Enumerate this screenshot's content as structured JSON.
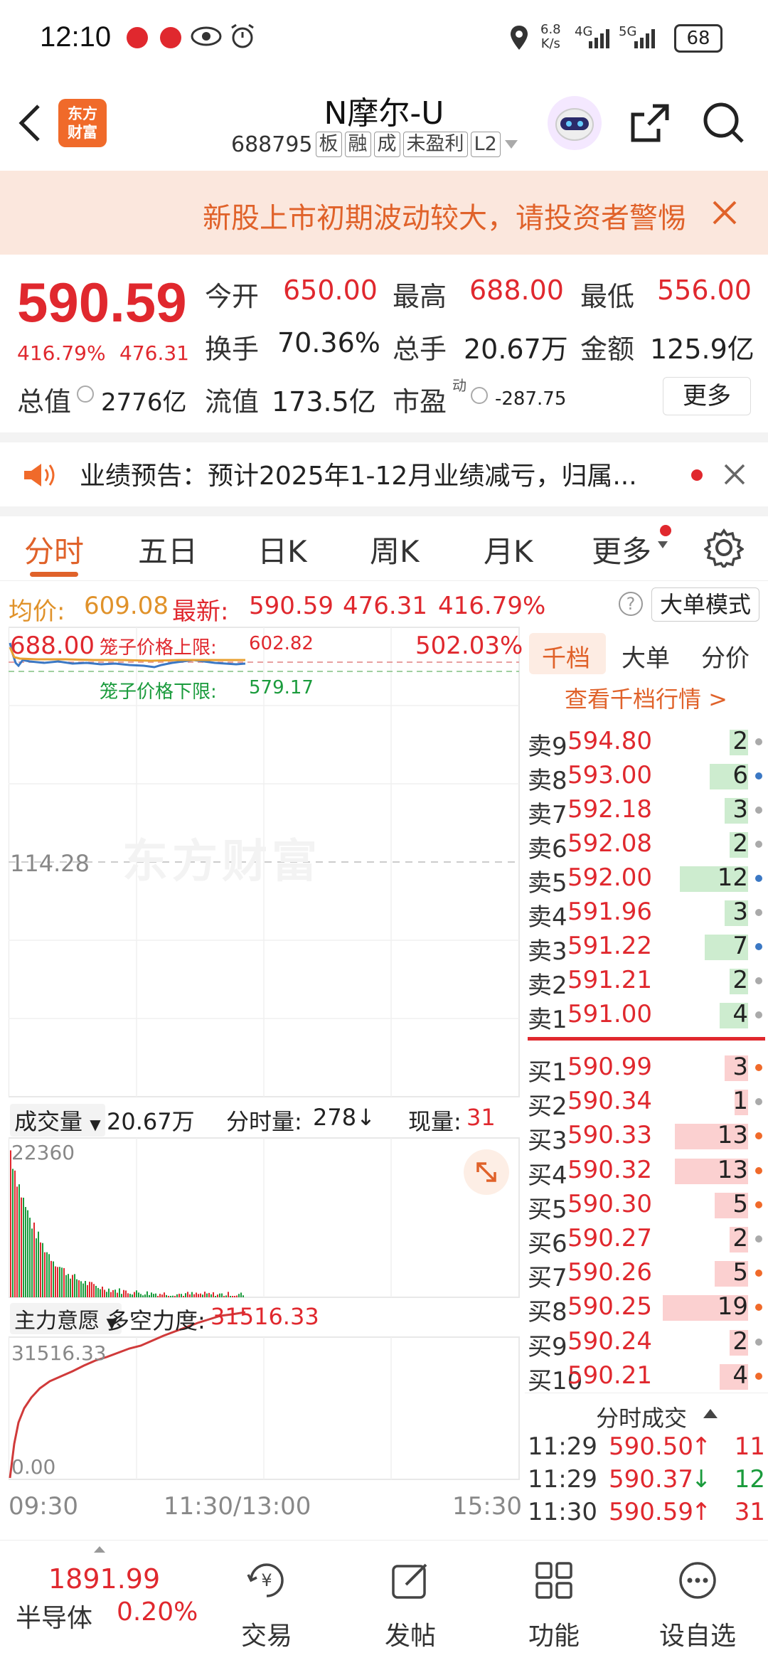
{
  "status": {
    "time": "12:10",
    "speed_value": "6.8",
    "speed_unit": "K/s",
    "net1": "4G",
    "net2": "5G",
    "battery": "68"
  },
  "header": {
    "title": "N摩尔-U",
    "code": "688795",
    "tags": [
      "板",
      "融",
      "成",
      "未盈利",
      "L2"
    ],
    "logo_line1": "东方",
    "logo_line2": "财富"
  },
  "banner": {
    "text": "新股上市初期波动较大，请投资者警惕"
  },
  "quote": {
    "price": "590.59",
    "change_pct": "416.79%",
    "change_amt": "476.31",
    "open_label": "今开",
    "open": "650.00",
    "high_label": "最高",
    "high": "688.00",
    "low_label": "最低",
    "low": "556.00",
    "turnover_label": "换手",
    "turnover": "70.36%",
    "volume_label": "总手",
    "volume": "20.67万",
    "amount_label": "金额",
    "amount": "125.9亿",
    "mktcap_label": "总值",
    "mktcap": "2776亿",
    "float_label": "流值",
    "float": "173.5亿",
    "pe_label": "市盈",
    "pe_sup": "动",
    "pe": "-287.75",
    "more": "更多"
  },
  "notice": {
    "text": "业绩预告：预计2025年1-12月业绩减亏，归属..."
  },
  "tabs": [
    "分时",
    "五日",
    "日K",
    "周K",
    "月K",
    "更多"
  ],
  "infoline": {
    "avg_label": "均价:",
    "avg": "609.08",
    "latest_label": "最新:",
    "latest": "590.59",
    "chg": "476.31",
    "pct": "416.79%",
    "mode": "大单模式"
  },
  "chart": {
    "top_price": "688.00",
    "top_pct": "502.03%",
    "cage_upper_label": "笼子价格上限:",
    "cage_upper": "602.82",
    "cage_lower_label": "笼子价格下限:",
    "cage_lower": "579.17",
    "mid_price": "114.28",
    "watermark": "东方财富",
    "vol_label": "成交量",
    "vol_total": "20.67万",
    "vol_min_label": "分时量:",
    "vol_min": "278↓",
    "vol_now_label": "现量:",
    "vol_now": "31",
    "vol_max": "22360",
    "force_label": "主力意愿",
    "force_name": "多空力度:",
    "force_val": "31516.33",
    "force_max": "31516.33",
    "force_min": "0.00",
    "time_start": "09:30",
    "time_mid": "11:30/13:00",
    "time_end": "15:30"
  },
  "orderbook": {
    "tabs": [
      "千档",
      "大单",
      "分价"
    ],
    "link": "查看千档行情 >",
    "sells": [
      {
        "label": "卖9",
        "price": "594.80",
        "qty": "2"
      },
      {
        "label": "卖8",
        "price": "593.00",
        "qty": "6"
      },
      {
        "label": "卖7",
        "price": "592.18",
        "qty": "3"
      },
      {
        "label": "卖6",
        "price": "592.08",
        "qty": "2"
      },
      {
        "label": "卖5",
        "price": "592.00",
        "qty": "12"
      },
      {
        "label": "卖4",
        "price": "591.96",
        "qty": "3"
      },
      {
        "label": "卖3",
        "price": "591.22",
        "qty": "7"
      },
      {
        "label": "卖2",
        "price": "591.21",
        "qty": "2"
      },
      {
        "label": "卖1",
        "price": "591.00",
        "qty": "4"
      }
    ],
    "buys": [
      {
        "label": "买1",
        "price": "590.99",
        "qty": "3"
      },
      {
        "label": "买2",
        "price": "590.34",
        "qty": "1"
      },
      {
        "label": "买3",
        "price": "590.33",
        "qty": "13"
      },
      {
        "label": "买4",
        "price": "590.32",
        "qty": "13"
      },
      {
        "label": "买5",
        "price": "590.30",
        "qty": "5"
      },
      {
        "label": "买6",
        "price": "590.27",
        "qty": "2"
      },
      {
        "label": "买7",
        "price": "590.26",
        "qty": "5"
      },
      {
        "label": "买8",
        "price": "590.25",
        "qty": "19"
      },
      {
        "label": "买9",
        "price": "590.24",
        "qty": "2"
      },
      {
        "label": "买10",
        "price": "590.21",
        "qty": "4"
      }
    ],
    "ticks_label": "分时成交",
    "ticks": [
      {
        "time": "11:29",
        "price": "590.50",
        "arrow": "↑",
        "qty": "11"
      },
      {
        "time": "11:29",
        "price": "590.37",
        "arrow": "↓",
        "qty": "12"
      },
      {
        "time": "11:30",
        "price": "590.59",
        "arrow": "↑",
        "qty": "31"
      }
    ]
  },
  "bottomnav": {
    "index_value": "1891.99",
    "index_name": "半导体",
    "index_pct": "0.20%",
    "items": [
      "交易",
      "发帖",
      "功能",
      "设自选"
    ]
  }
}
